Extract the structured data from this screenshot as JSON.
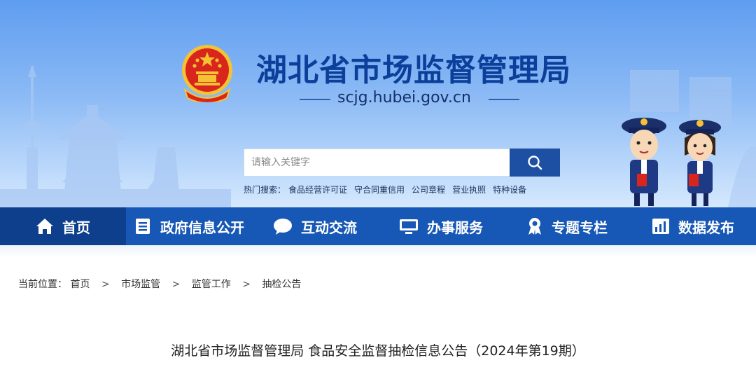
{
  "header": {
    "site_title": "湖北省市场监督管理局",
    "site_domain": "scjg.hubei.gov.cn"
  },
  "search": {
    "placeholder": "请输入关键字",
    "button_icon": "search-icon",
    "hot_label": "热门搜索：",
    "hot_terms": [
      "食品经营许可证",
      "守合同重信用",
      "公司章程",
      "营业执照",
      "特种设备"
    ]
  },
  "nav": {
    "items": [
      {
        "label": "首页",
        "icon": "home-icon"
      },
      {
        "label": "政府信息公开",
        "icon": "document-icon"
      },
      {
        "label": "互动交流",
        "icon": "chat-bubble-icon"
      },
      {
        "label": "办事服务",
        "icon": "monitor-icon"
      },
      {
        "label": "专题专栏",
        "icon": "award-ribbon-icon"
      },
      {
        "label": "数据发布",
        "icon": "bar-chart-icon"
      }
    ],
    "active_index": 0
  },
  "breadcrumb": {
    "label": "当前位置：",
    "items": [
      "首页",
      "市场监管",
      "监管工作",
      "抽检公告"
    ],
    "separator": ">"
  },
  "article": {
    "title": "湖北省市场监督管理局 食品安全监督抽检信息公告（2024年第19期）"
  },
  "colors": {
    "nav_bg": "#1757b5",
    "nav_active_bg": "#0d3f8c",
    "title_blue": "#0b3f9a",
    "emblem_red": "#d8261d",
    "emblem_gold": "#f4c233"
  }
}
